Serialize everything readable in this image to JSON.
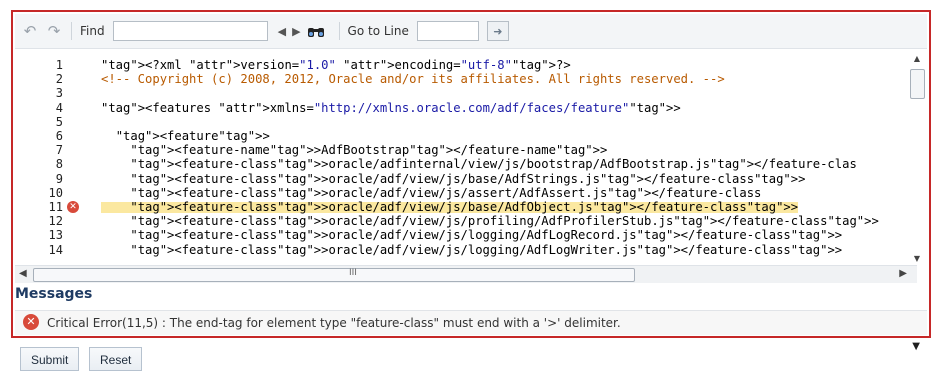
{
  "toolbar": {
    "undo_icon": "undo-icon",
    "redo_icon": "redo-icon",
    "find_label": "Find",
    "find_value": "",
    "prev_icon": "◀",
    "next_icon": "▶",
    "binoculars_icon": "binoculars-icon",
    "goto_label": "Go to Line",
    "goto_value": "",
    "goto_button_icon": "➜"
  },
  "editor": {
    "lines": [
      {
        "n": "1",
        "code": "<?xml version=\"1.0\" encoding=\"utf-8\"?>"
      },
      {
        "n": "2",
        "code": "<!-- Copyright (c) 2008, 2012, Oracle and/or its affiliates. All rights reserved. -->"
      },
      {
        "n": "3",
        "code": ""
      },
      {
        "n": "4",
        "code": "<features xmlns=\"http://xmlns.oracle.com/adf/faces/feature\">"
      },
      {
        "n": "5",
        "code": ""
      },
      {
        "n": "6",
        "code": "  <feature>"
      },
      {
        "n": "7",
        "code": "    <feature-name>AdfBootstrap</feature-name>"
      },
      {
        "n": "8",
        "code": "    <feature-class>oracle/adfinternal/view/js/bootstrap/AdfBootstrap.js</feature-clas"
      },
      {
        "n": "9",
        "code": "    <feature-class>oracle/adf/view/js/base/AdfStrings.js</feature-class>"
      },
      {
        "n": "10",
        "code": "    <feature-class>oracle/adf/view/js/assert/AdfAssert.js</feature-class"
      },
      {
        "n": "11",
        "code": "    <feature-class>oracle/adf/view/js/base/AdfObject.js</feature-class>",
        "error": true
      },
      {
        "n": "12",
        "code": "    <feature-class>oracle/adf/view/js/profiling/AdfProfilerStub.js</feature-class>"
      },
      {
        "n": "13",
        "code": "    <feature-class>oracle/adf/view/js/logging/AdfLogRecord.js</feature-class>"
      },
      {
        "n": "14",
        "code": "    <feature-class>oracle/adf/view/js/logging/AdfLogWriter.js</feature-class>"
      }
    ]
  },
  "scroll": {
    "horizontal_grip": "III"
  },
  "messages": {
    "title": "Messages",
    "items": [
      {
        "text": "Critical Error(11,5) : The end-tag for element type \"feature-class\" must end with a '>' delimiter."
      }
    ]
  },
  "footer": {
    "submit_label": "Submit",
    "reset_label": "Reset"
  },
  "colors": {
    "frame_border": "#c62828",
    "error": "#d84a3a",
    "tag": "#8b1a1a",
    "comment": "#b85a00",
    "attr": "#1a1aa6"
  }
}
